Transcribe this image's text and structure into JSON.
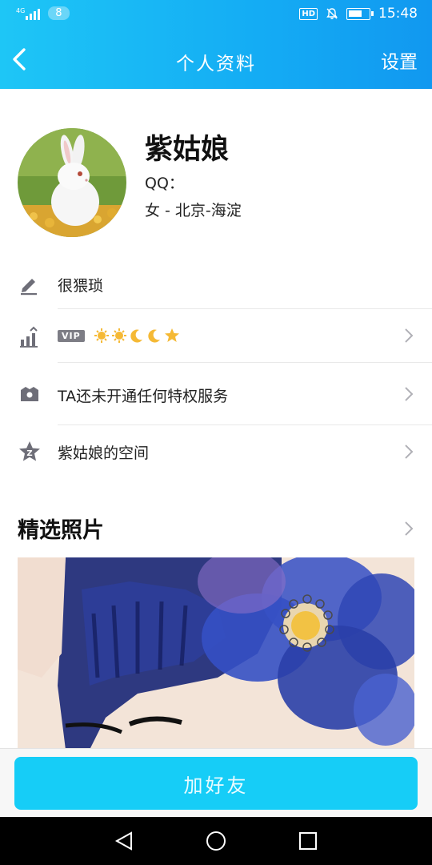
{
  "status_bar": {
    "network": "4G",
    "notification_count": "8",
    "hd_label": "HD",
    "time": "15:48",
    "icons": [
      "signal-icon",
      "bell-muted-icon",
      "battery-charging-icon"
    ]
  },
  "nav": {
    "title": "个人资料",
    "settings_label": "设置",
    "back_icon": "chevron-left-icon"
  },
  "profile": {
    "name": "紫姑娘",
    "qq_label": "QQ：",
    "location": "女 - 北京-海淀",
    "avatar_icon": "rabbit-avatar"
  },
  "list": {
    "signature": "很猥琐",
    "vip_badge": "VIP",
    "level_icons": [
      "sun",
      "sun",
      "moon",
      "moon",
      "star"
    ],
    "privilege": "TA还未开通任何特权服务",
    "space": "紫姑娘的空间"
  },
  "photos": {
    "title": "精选照片",
    "image_icon": "watercolor-girl-with-flower"
  },
  "actions": {
    "add_friend": "加好友"
  },
  "colors": {
    "header_start": "#1ec6f6",
    "header_end": "#1198f0",
    "add_button": "#16cdf7"
  }
}
